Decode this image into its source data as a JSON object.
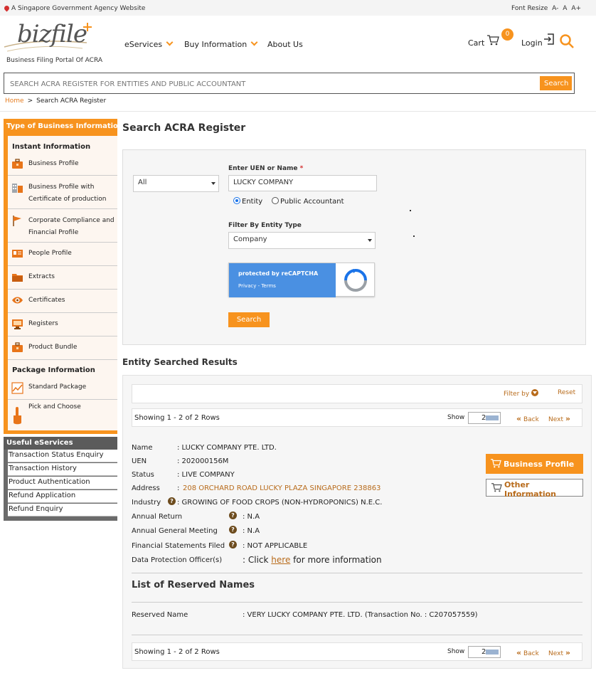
{
  "gov_banner": "A Singapore Government Agency Website",
  "font_resize": {
    "label": "Font Resize",
    "smaller": "A-",
    "normal": "A",
    "larger": "A+"
  },
  "logo": {
    "text": "bizfile",
    "subtitle": "Business Filing Portal Of ACRA"
  },
  "nav": [
    {
      "label": "eServices",
      "has_dropdown": true
    },
    {
      "label": "Buy Information",
      "has_dropdown": true
    },
    {
      "label": "About Us",
      "has_dropdown": false
    }
  ],
  "header": {
    "cart_label": "Cart",
    "cart_count": "0",
    "login_label": "Login"
  },
  "global_search": {
    "placeholder": "SEARCH ACRA REGISTER FOR ENTITIES AND PUBLIC ACCOUNTANT",
    "button": "Search"
  },
  "breadcrumb": {
    "home": "Home",
    "sep": ">",
    "current": "Search ACRA Register"
  },
  "sidebar": {
    "type_title": "Type of Business Information",
    "instant_title": "Instant Information",
    "instant_items": [
      {
        "label": "Business Profile",
        "icon": "briefcase-icon"
      },
      {
        "label": "Business Profile with",
        "label2": "Certificate of production",
        "icon": "building-icon"
      },
      {
        "label": "Corporate Compliance and",
        "label2": "Financial Profile",
        "icon": "flag-icon"
      },
      {
        "label": "People Profile",
        "icon": "id-card-icon"
      },
      {
        "label": "Extracts",
        "icon": "folder-icon"
      },
      {
        "label": "Certificates",
        "icon": "eye-icon"
      },
      {
        "label": "Registers",
        "icon": "monitor-icon"
      },
      {
        "label": "Product Bundle",
        "icon": "briefcase-icon"
      }
    ],
    "package_title": "Package Information",
    "package_items": [
      {
        "label": "Standard Package",
        "icon": "chart-icon"
      },
      {
        "label": "Pick and Choose",
        "icon": "hand-pointer-icon"
      }
    ],
    "useful_title": "Useful eServices",
    "useful_items": [
      "Transaction Status Enquiry",
      "Transaction History",
      "Product Authentication",
      "Refund Application",
      "Refund Enquiry"
    ]
  },
  "page_title": "Search ACRA Register",
  "form": {
    "scope_select": "All",
    "uen_label": "Enter UEN or Name",
    "required_mark": "*",
    "uen_value": "LUCKY COMPANY",
    "radio_entity": "Entity",
    "radio_pa": "Public Accountant",
    "selected_radio": "Entity",
    "filter_label": "Filter By Entity Type",
    "filter_value": "Company",
    "captcha_line1": "protected by reCAPTCHA",
    "captcha_line2": "Privacy - Terms",
    "search_button": "Search"
  },
  "results": {
    "title": "Entity Searched Results",
    "filter_by": "Filter by",
    "reset": "Reset",
    "showing": "Showing 1 - 2 of 2 Rows",
    "show_label": "Show",
    "page_size": "2",
    "back": "Back",
    "next": "Next",
    "entity": {
      "name_label": "Name",
      "name_value": ": LUCKY COMPANY PTE. LTD.",
      "uen_label": "UEN",
      "uen_value": ": 202000156M",
      "status_label": "Status",
      "status_value": ": LIVE COMPANY",
      "address_label": "Address",
      "address_colon": ":",
      "address_value": "208 ORCHARD ROAD LUCKY PLAZA SINGAPORE 238863",
      "industry_label": "Industry",
      "industry_value": ": GROWING OF FOOD CROPS (NON-HYDROPONICS) N.E.C.",
      "ar_label": "Annual Return",
      "ar_value": ": N.A",
      "agm_label": "Annual General Meeting",
      "agm_value": ": N.A",
      "fs_label": "Financial Statements Filed",
      "fs_value": ": NOT APPLICABLE",
      "dpo_label": "Data Protection Officer(s)",
      "dpo_prefix": ": Click",
      "dpo_link": "here",
      "dpo_suffix": "for more information"
    },
    "business_profile_btn": "Business Profile",
    "other_info_btn": "Other Information",
    "reserved_title": "List of Reserved Names",
    "reserved_label": "Reserved Name",
    "reserved_value": ": VERY LUCKY COMPANY PTE. LTD. (Transaction No. : C207057559)"
  },
  "colors": {
    "accent": "#f7931e",
    "link": "#b86b1b",
    "sidebar_bg": "#fdf6f0",
    "useful_header": "#5b5b5b"
  }
}
